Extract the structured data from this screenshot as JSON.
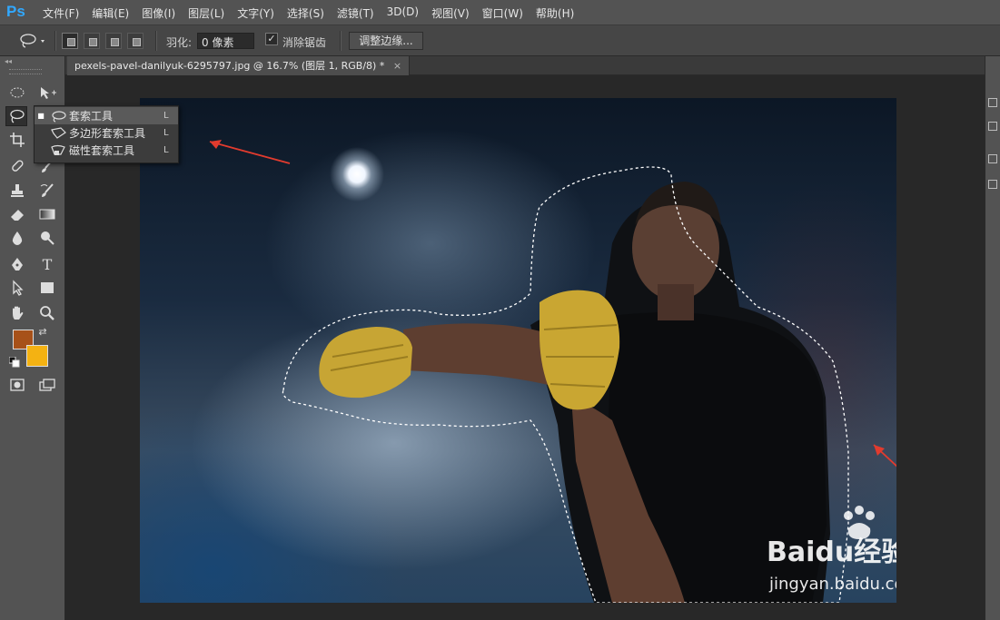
{
  "app": {
    "logo": "Ps"
  },
  "menu": [
    "文件(F)",
    "编辑(E)",
    "图像(I)",
    "图层(L)",
    "文字(Y)",
    "选择(S)",
    "滤镜(T)",
    "3D(D)",
    "视图(V)",
    "窗口(W)",
    "帮助(H)"
  ],
  "options": {
    "feather_label": "羽化:",
    "feather_value": "0 像素",
    "antialias_label": "消除锯齿",
    "antialias_checked": true,
    "refine_edge_label": "调整边缘..."
  },
  "document": {
    "tab_title": "pexels-pavel-danilyuk-6295797.jpg @ 16.7% (图层 1, RGB/8) *",
    "close": "×"
  },
  "tools": {
    "type_glyph": "T",
    "foreground_color": "#a75119",
    "background_color": "#f4b212"
  },
  "lasso_flyout": [
    {
      "label": "套索工具",
      "shortcut": "L",
      "icon": "lasso-icon",
      "selected": true
    },
    {
      "label": "多边形套索工具",
      "shortcut": "L",
      "icon": "polygon-lasso-icon",
      "selected": false
    },
    {
      "label": "磁性套索工具",
      "shortcut": "L",
      "icon": "magnetic-lasso-icon",
      "selected": false
    }
  ],
  "watermark": {
    "brand": "Baidu经验",
    "url": "jingyan.baidu.com"
  }
}
